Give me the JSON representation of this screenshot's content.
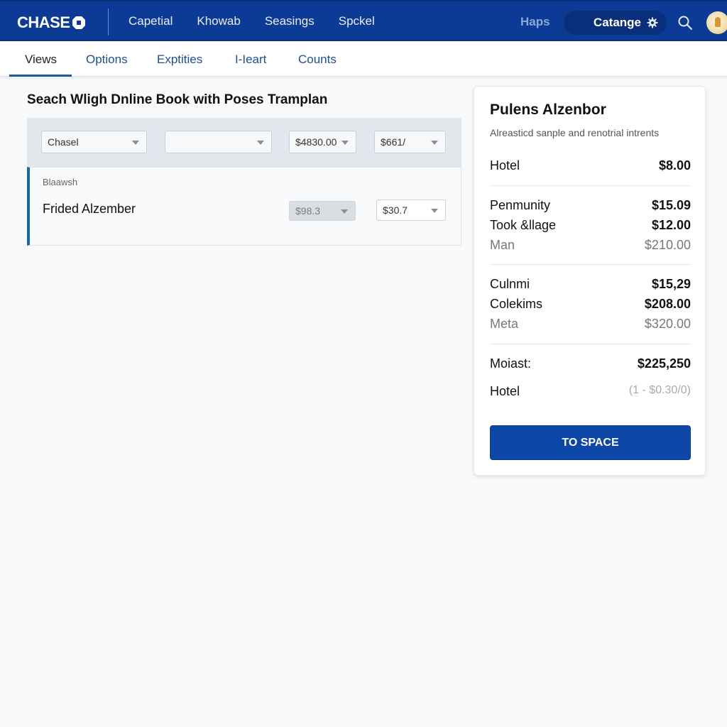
{
  "brand": {
    "name": "CHASE",
    "color": "#0c3b96",
    "accent": "#0d48a8"
  },
  "topnav": {
    "items": [
      "Capetial",
      "Khowab",
      "Seasings",
      "Spckel"
    ],
    "haps": "Haps",
    "pill_label": "Catange",
    "icons": {
      "settings": "gear-icon",
      "search": "search-icon",
      "avatar": "avatar"
    }
  },
  "subnav": {
    "tabs": [
      {
        "label": "Views",
        "active": true
      },
      {
        "label": "Options",
        "active": false
      },
      {
        "label": "Exptities",
        "active": false
      },
      {
        "label": "I-Ieart",
        "active": false
      },
      {
        "label": "Counts",
        "active": false
      }
    ]
  },
  "main": {
    "title": "Seach Wligh Dnline Book with Poses Tramplan",
    "filters": [
      {
        "value": "Chasel"
      },
      {
        "value": ""
      },
      {
        "value": "$4830.00"
      },
      {
        "value": "$661/"
      }
    ],
    "result": {
      "label": "Blaawsh",
      "name": "Frided Alzember",
      "select1": "$98.3",
      "select2": "$30.7"
    }
  },
  "summary": {
    "title": "Pulens Alzenbor",
    "subtitle": "Alreasticd sanple and renotrial intrents",
    "rows": [
      {
        "label": "Hotel",
        "value": "$8.00"
      },
      {
        "label": "Penmunity",
        "value": "$15.09"
      },
      {
        "label": "Took &llage",
        "value": "$12.00"
      },
      {
        "label": "Man",
        "value": "$210.00"
      },
      {
        "label": "Culnmi",
        "value": "$15,29"
      },
      {
        "label": "Colekims",
        "value": "$208.00"
      },
      {
        "label": "Meta",
        "value": "$320.00"
      },
      {
        "label": "Moiast:",
        "value": "$225,250"
      },
      {
        "label": "Hotel",
        "value": "(1 - $0.30/0)"
      }
    ],
    "cta_label": "TO SPACE"
  }
}
